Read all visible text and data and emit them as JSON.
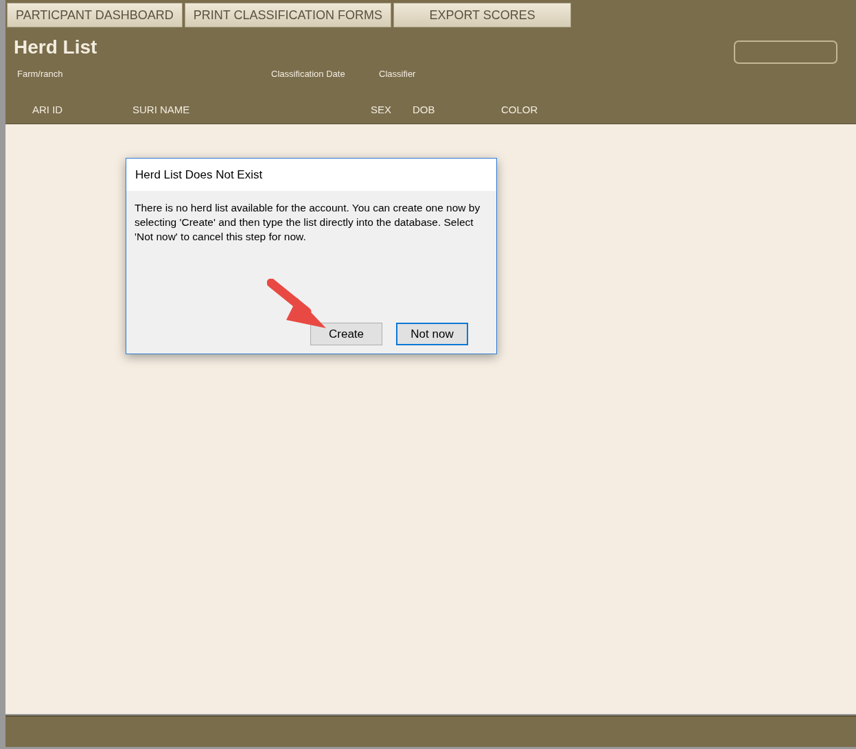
{
  "tabs": [
    {
      "label": "PARTICPANT DASHBOARD"
    },
    {
      "label": "PRINT CLASSIFICATION FORMS"
    },
    {
      "label": "EXPORT SCORES"
    }
  ],
  "title": "Herd List",
  "fields": [
    {
      "label": "Farm/ranch"
    },
    {
      "label": "Classification Date"
    },
    {
      "label": "Classifier"
    }
  ],
  "columns": [
    "ARI ID",
    "SURI NAME",
    "SEX",
    "DOB",
    "COLOR"
  ],
  "dialog": {
    "title": "Herd List Does Not Exist",
    "message": "There is no herd list available for the account. You can create one now by selecting 'Create' and then type the list directly into the database.  Select 'Not now' to cancel this step for now.",
    "buttons": [
      {
        "label": "Create",
        "focused": false
      },
      {
        "label": "Not now",
        "focused": true
      }
    ]
  }
}
